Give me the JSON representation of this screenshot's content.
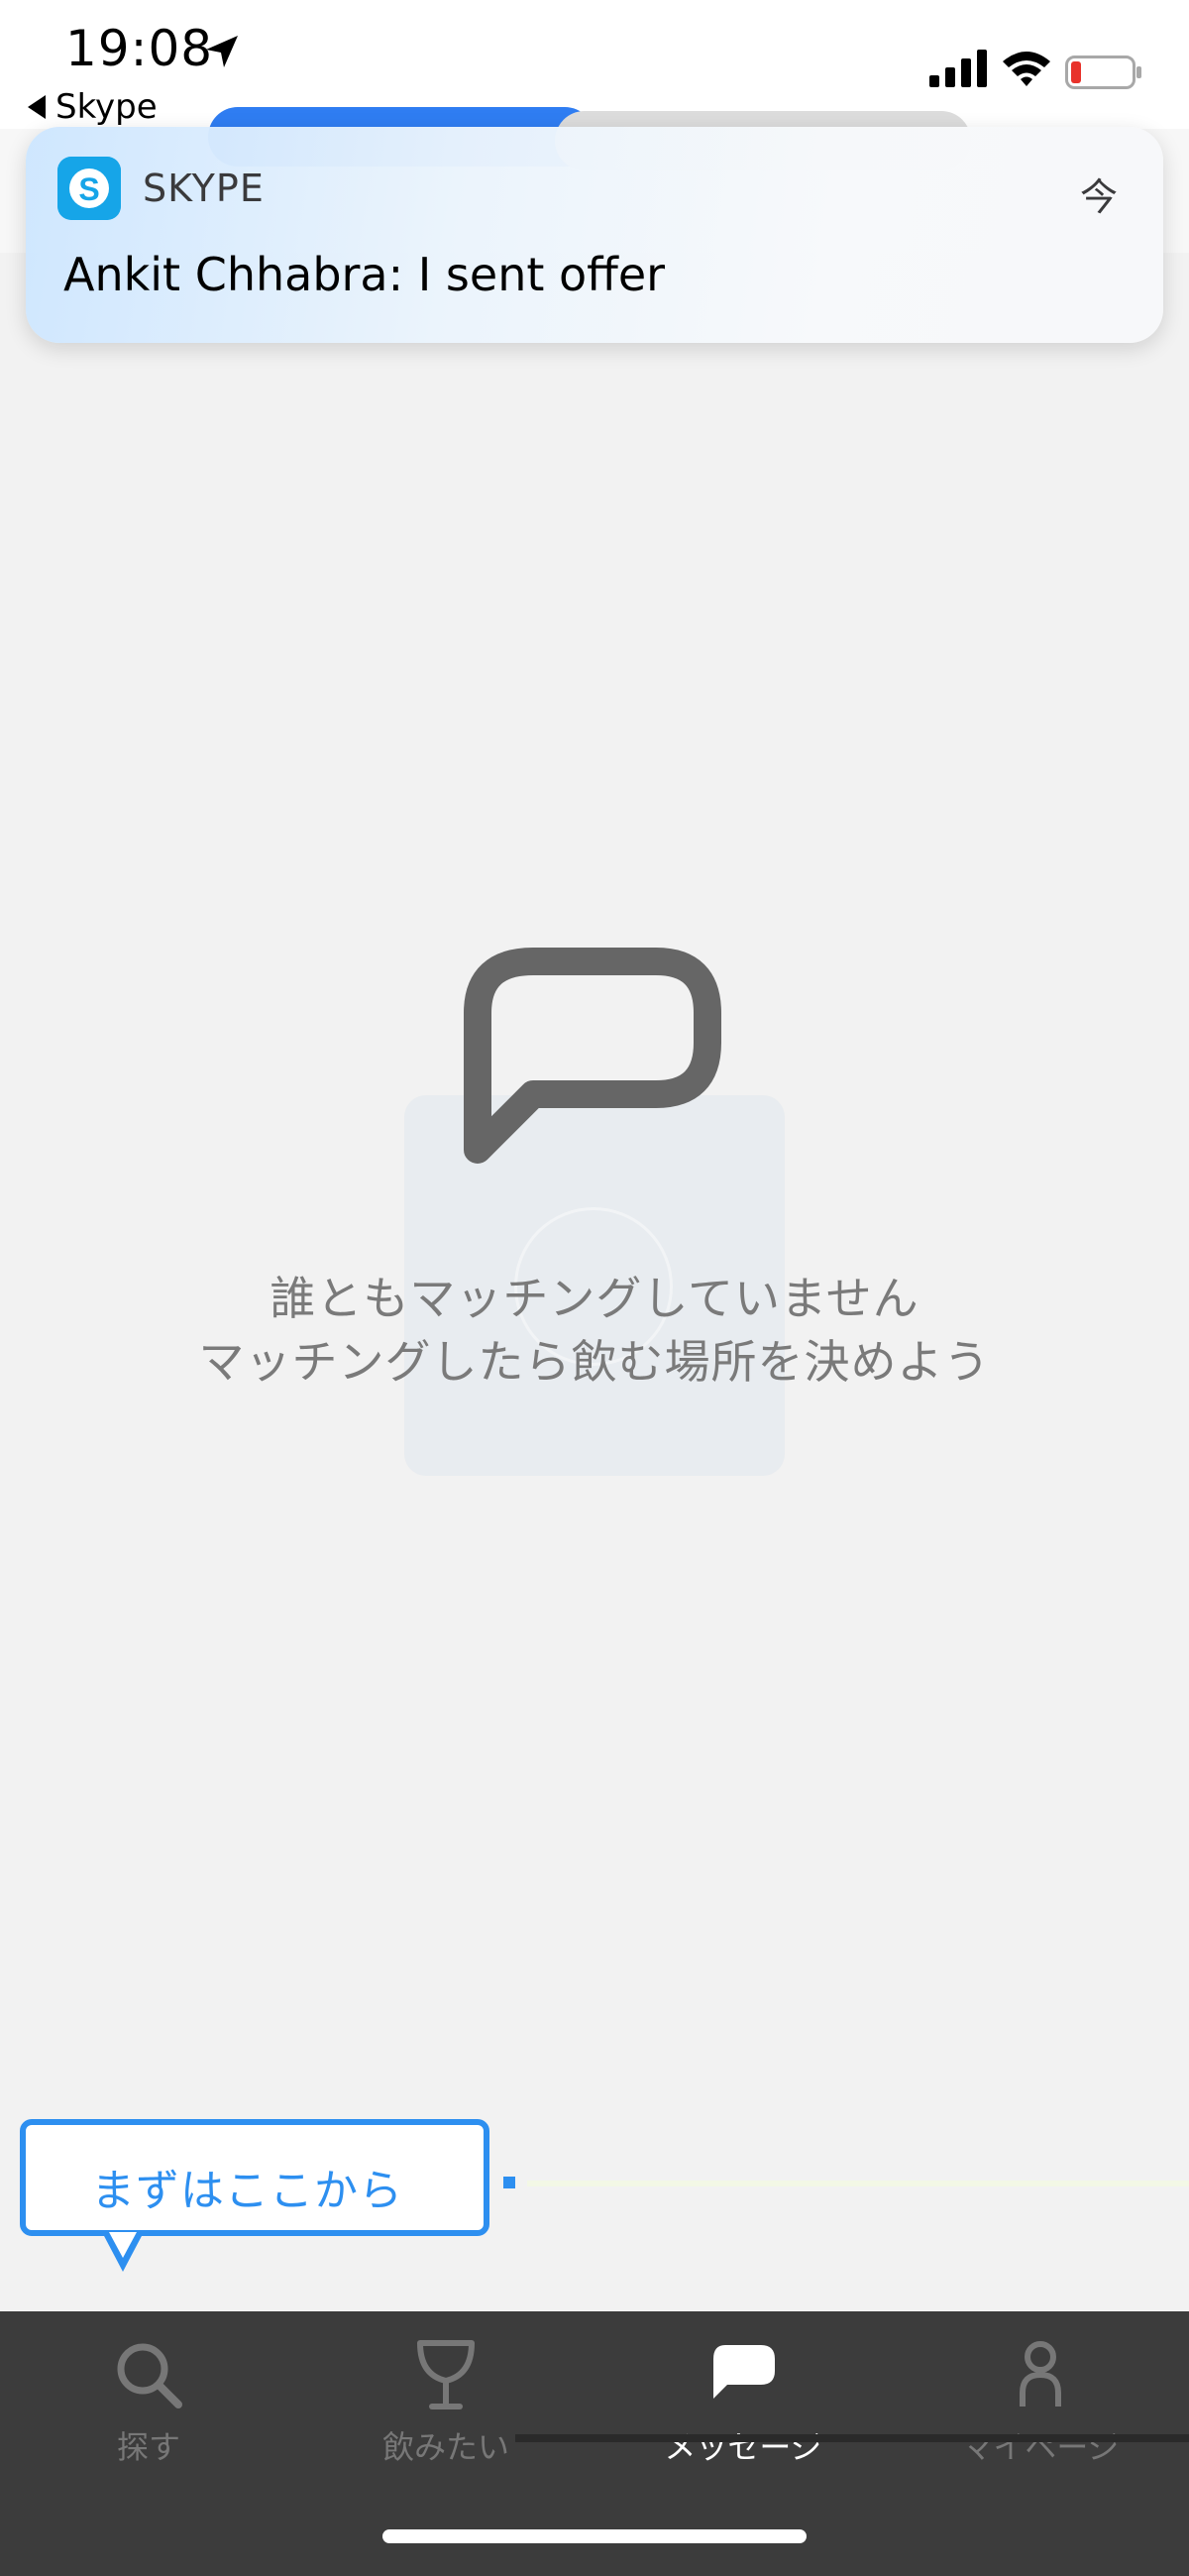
{
  "status_bar": {
    "time": "19:08",
    "back_app": "Skype",
    "icons": [
      "location-arrow-icon",
      "cellular-signal-icon",
      "wifi-icon",
      "battery-low-icon"
    ]
  },
  "notification": {
    "app_name": "SKYPE",
    "time": "今",
    "message": "Ankit Chhabra: I sent offer",
    "app_icon": "skype-icon"
  },
  "empty_state": {
    "icon": "chat-bubble-icon",
    "line1": "誰ともマッチングしていません",
    "line2": "マッチングしたら飲む場所を決めよう"
  },
  "tooltip": {
    "text": "まずはここから"
  },
  "tab_bar": {
    "active": "messages",
    "tabs": [
      {
        "id": "search",
        "label": "探す",
        "icon": "search-icon"
      },
      {
        "id": "wishlist",
        "label": "飲みたい",
        "icon": "cocktail-glass-icon"
      },
      {
        "id": "messages",
        "label": "メッセージ",
        "icon": "chat-bubble-icon"
      },
      {
        "id": "mypage",
        "label": "マイページ",
        "icon": "person-icon"
      }
    ]
  },
  "colors": {
    "accent_blue": "#2d8ff0",
    "skype_blue": "#16a5e8",
    "tab_bar_bg": "#3c3c3c",
    "background": "#f2f2f2"
  }
}
